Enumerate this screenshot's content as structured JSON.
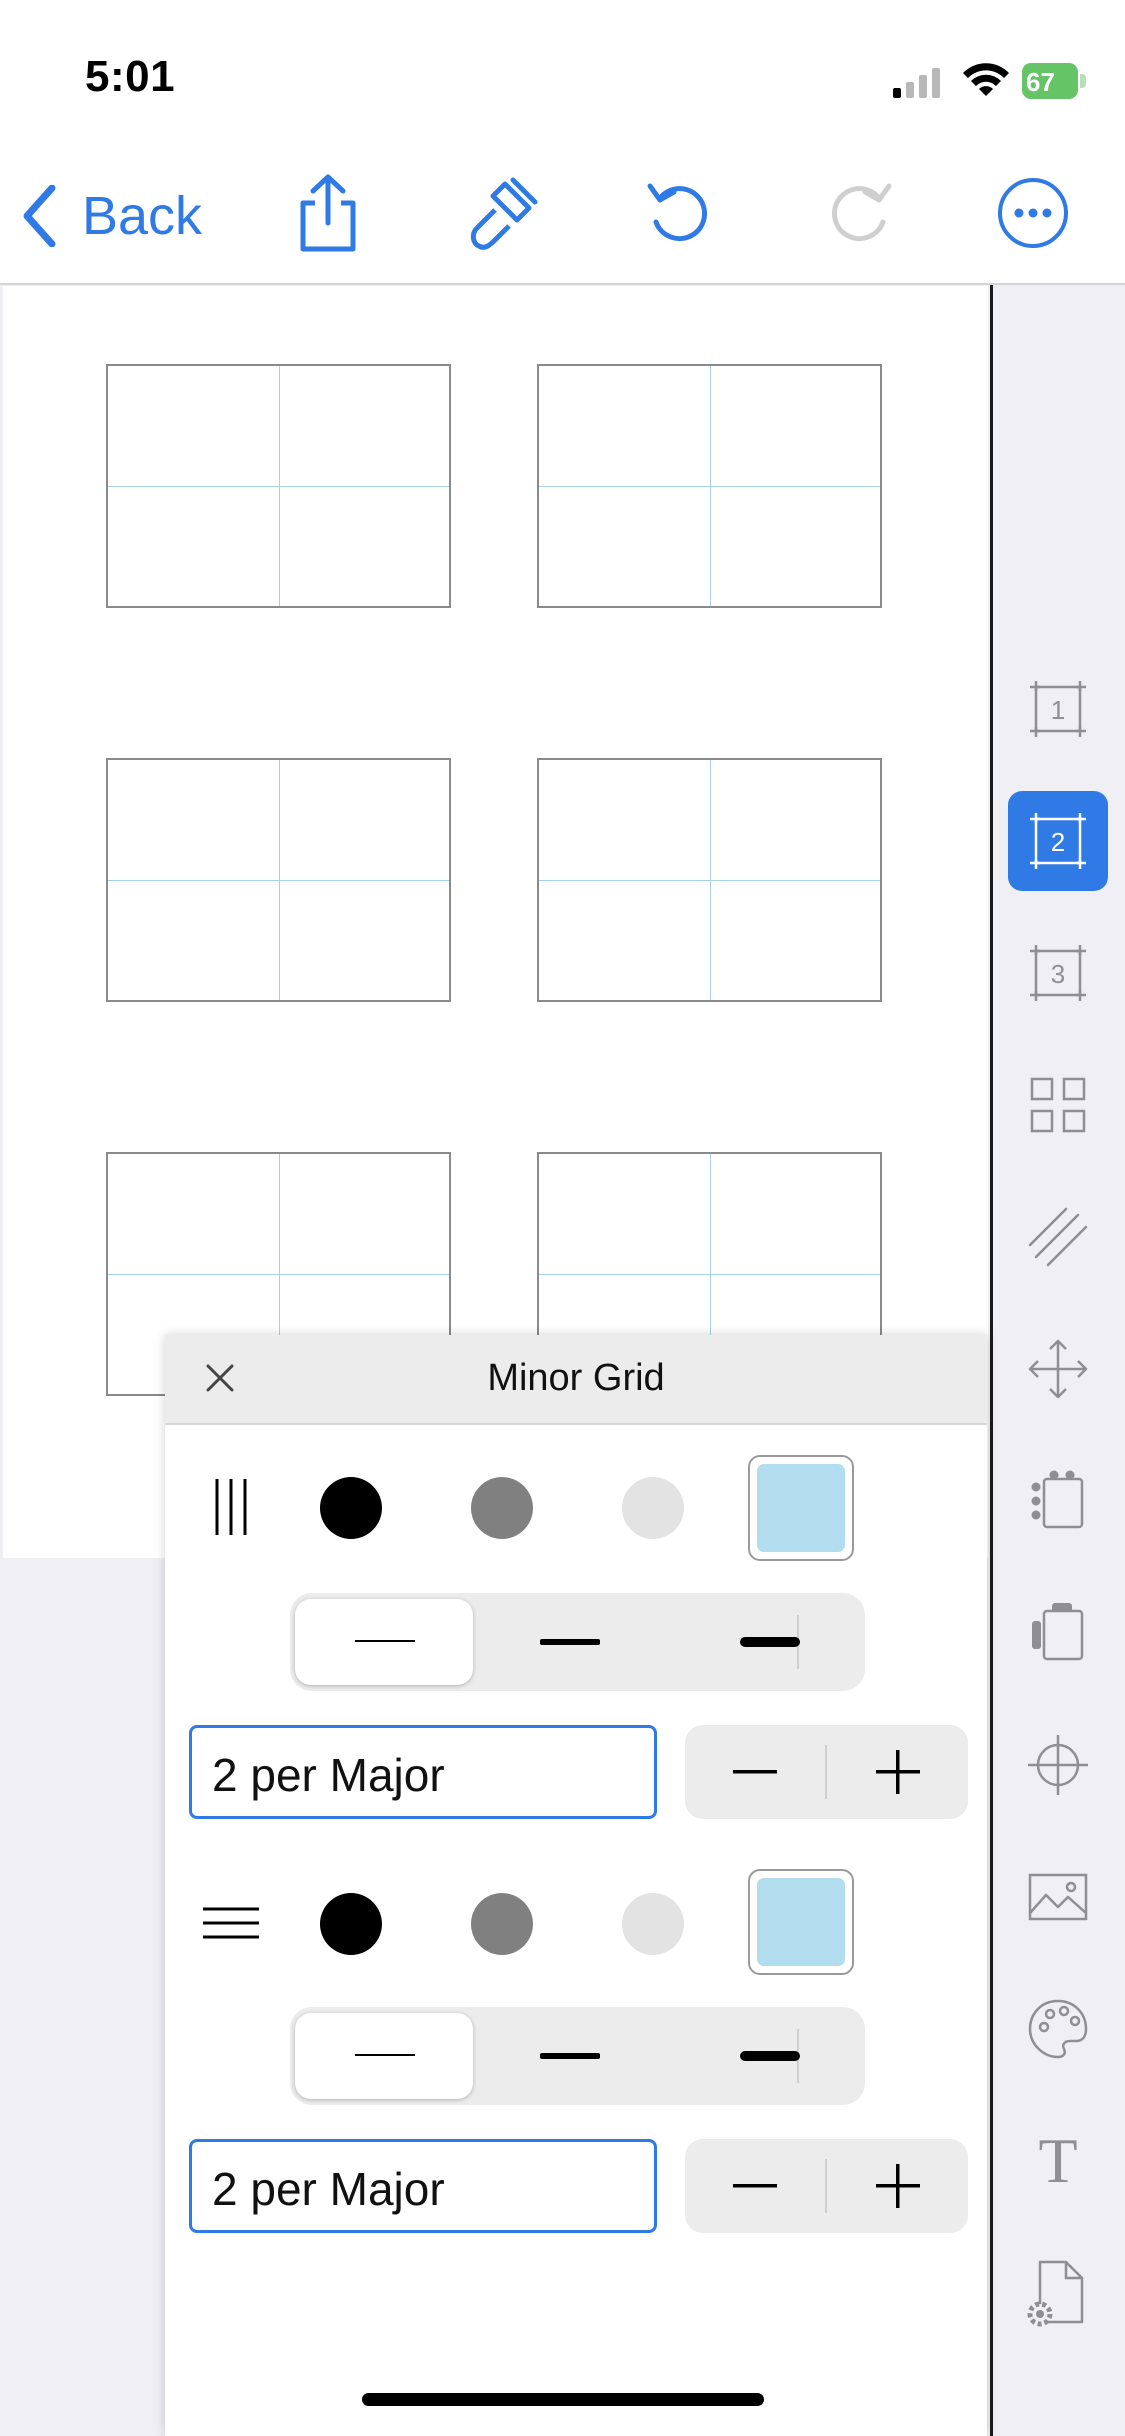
{
  "status": {
    "time": "5:01",
    "battery": "67"
  },
  "nav": {
    "back_label": "Back"
  },
  "sidebar": {
    "items": [
      {
        "name": "page-1",
        "label": "1"
      },
      {
        "name": "page-2",
        "label": "2",
        "selected": true
      },
      {
        "name": "page-3",
        "label": "3"
      },
      {
        "name": "grid-layout"
      },
      {
        "name": "hatch"
      },
      {
        "name": "move"
      },
      {
        "name": "dots-page"
      },
      {
        "name": "page-tab"
      },
      {
        "name": "crosshair"
      },
      {
        "name": "image"
      },
      {
        "name": "palette"
      },
      {
        "name": "text",
        "label": "T"
      },
      {
        "name": "page-settings"
      }
    ]
  },
  "panel": {
    "title": "Minor Grid",
    "vertical": {
      "colors": [
        "#000000",
        "#808080",
        "#e3e3e3"
      ],
      "custom_color": "#b2ddef",
      "thickness_options": [
        "thin",
        "medium",
        "thick"
      ],
      "selected_thickness": "thin",
      "count_value": "2 per Major"
    },
    "horizontal": {
      "colors": [
        "#000000",
        "#808080",
        "#e3e3e3"
      ],
      "custom_color": "#b2ddef",
      "thickness_options": [
        "thin",
        "medium",
        "thick"
      ],
      "selected_thickness": "thin",
      "count_value": "2 per Major"
    },
    "stepper": {
      "minus": "−",
      "plus": "+"
    }
  },
  "colors": {
    "accent": "#2f7ae5",
    "grid_minor": "#a8d3e6",
    "grid_major": "#8a8a8a"
  }
}
